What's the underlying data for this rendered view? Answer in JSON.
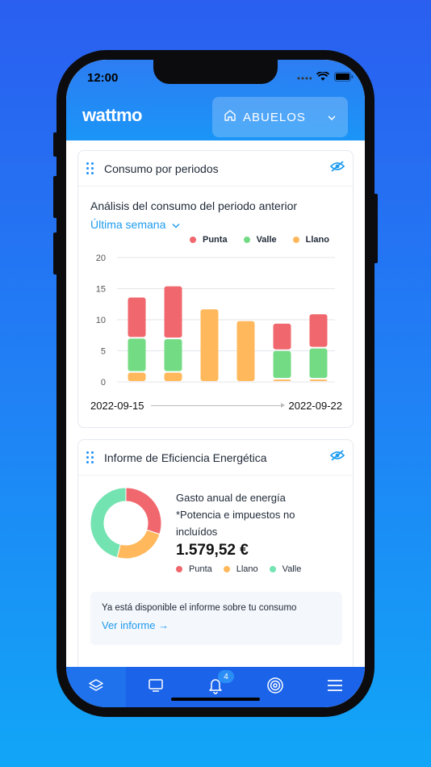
{
  "status_bar": {
    "time": "12:00"
  },
  "header": {
    "logo": "wattmo",
    "home_selector": {
      "value": "ABUELOS",
      "icon": "home-icon"
    }
  },
  "card_consumo": {
    "title": "Consumo por periodos",
    "subtitle": "Análisis del consumo del periodo anterior",
    "period_label": "Última semana",
    "date_start": "2022-09-15",
    "date_end": "2022-09-22"
  },
  "chart_data": {
    "type": "bar",
    "stacked": true,
    "categories": [
      "",
      "",
      "",
      "",
      "",
      ""
    ],
    "ylim": [
      0,
      20
    ],
    "yticks": [
      0,
      5,
      10,
      15,
      20
    ],
    "grid": true,
    "legend_position": "top-right",
    "series": [
      {
        "name": "Llano",
        "color": "#ffb85c",
        "values": [
          1.6,
          1.6,
          11.8,
          9.9,
          0.5,
          0.5
        ]
      },
      {
        "name": "Valle",
        "color": "#74db85",
        "values": [
          5.5,
          5.4,
          0,
          0,
          4.6,
          5.0
        ]
      },
      {
        "name": "Punta",
        "color": "#f0676e",
        "values": [
          6.6,
          8.5,
          0,
          0,
          4.4,
          5.5
        ]
      }
    ],
    "legend_order": [
      "Punta",
      "Valle",
      "Llano"
    ]
  },
  "card_informe": {
    "title": "Informe de Eficiencia Energética",
    "report_title": "Gasto anual de energía",
    "note": "*Potencia e impuestos no incluídos",
    "amount": "1.579,52 €",
    "legend": [
      "Punta",
      "Llano",
      "Valle"
    ],
    "notice_text": "Ya está disponible el informe sobre tu consumo",
    "notice_link": "Ver informe →"
  },
  "donut_data": {
    "type": "pie",
    "segments": [
      {
        "name": "Punta",
        "color": "#f0676e",
        "value": 30
      },
      {
        "name": "Llano",
        "color": "#ffb85c",
        "value": 24
      },
      {
        "name": "Valle",
        "color": "#74e3b2",
        "value": 46
      }
    ]
  },
  "tabbar": {
    "tabs": [
      {
        "name": "layers-icon"
      },
      {
        "name": "tv-icon"
      },
      {
        "name": "bell-icon",
        "badge": "4"
      },
      {
        "name": "target-icon"
      },
      {
        "name": "menu-icon"
      }
    ]
  }
}
